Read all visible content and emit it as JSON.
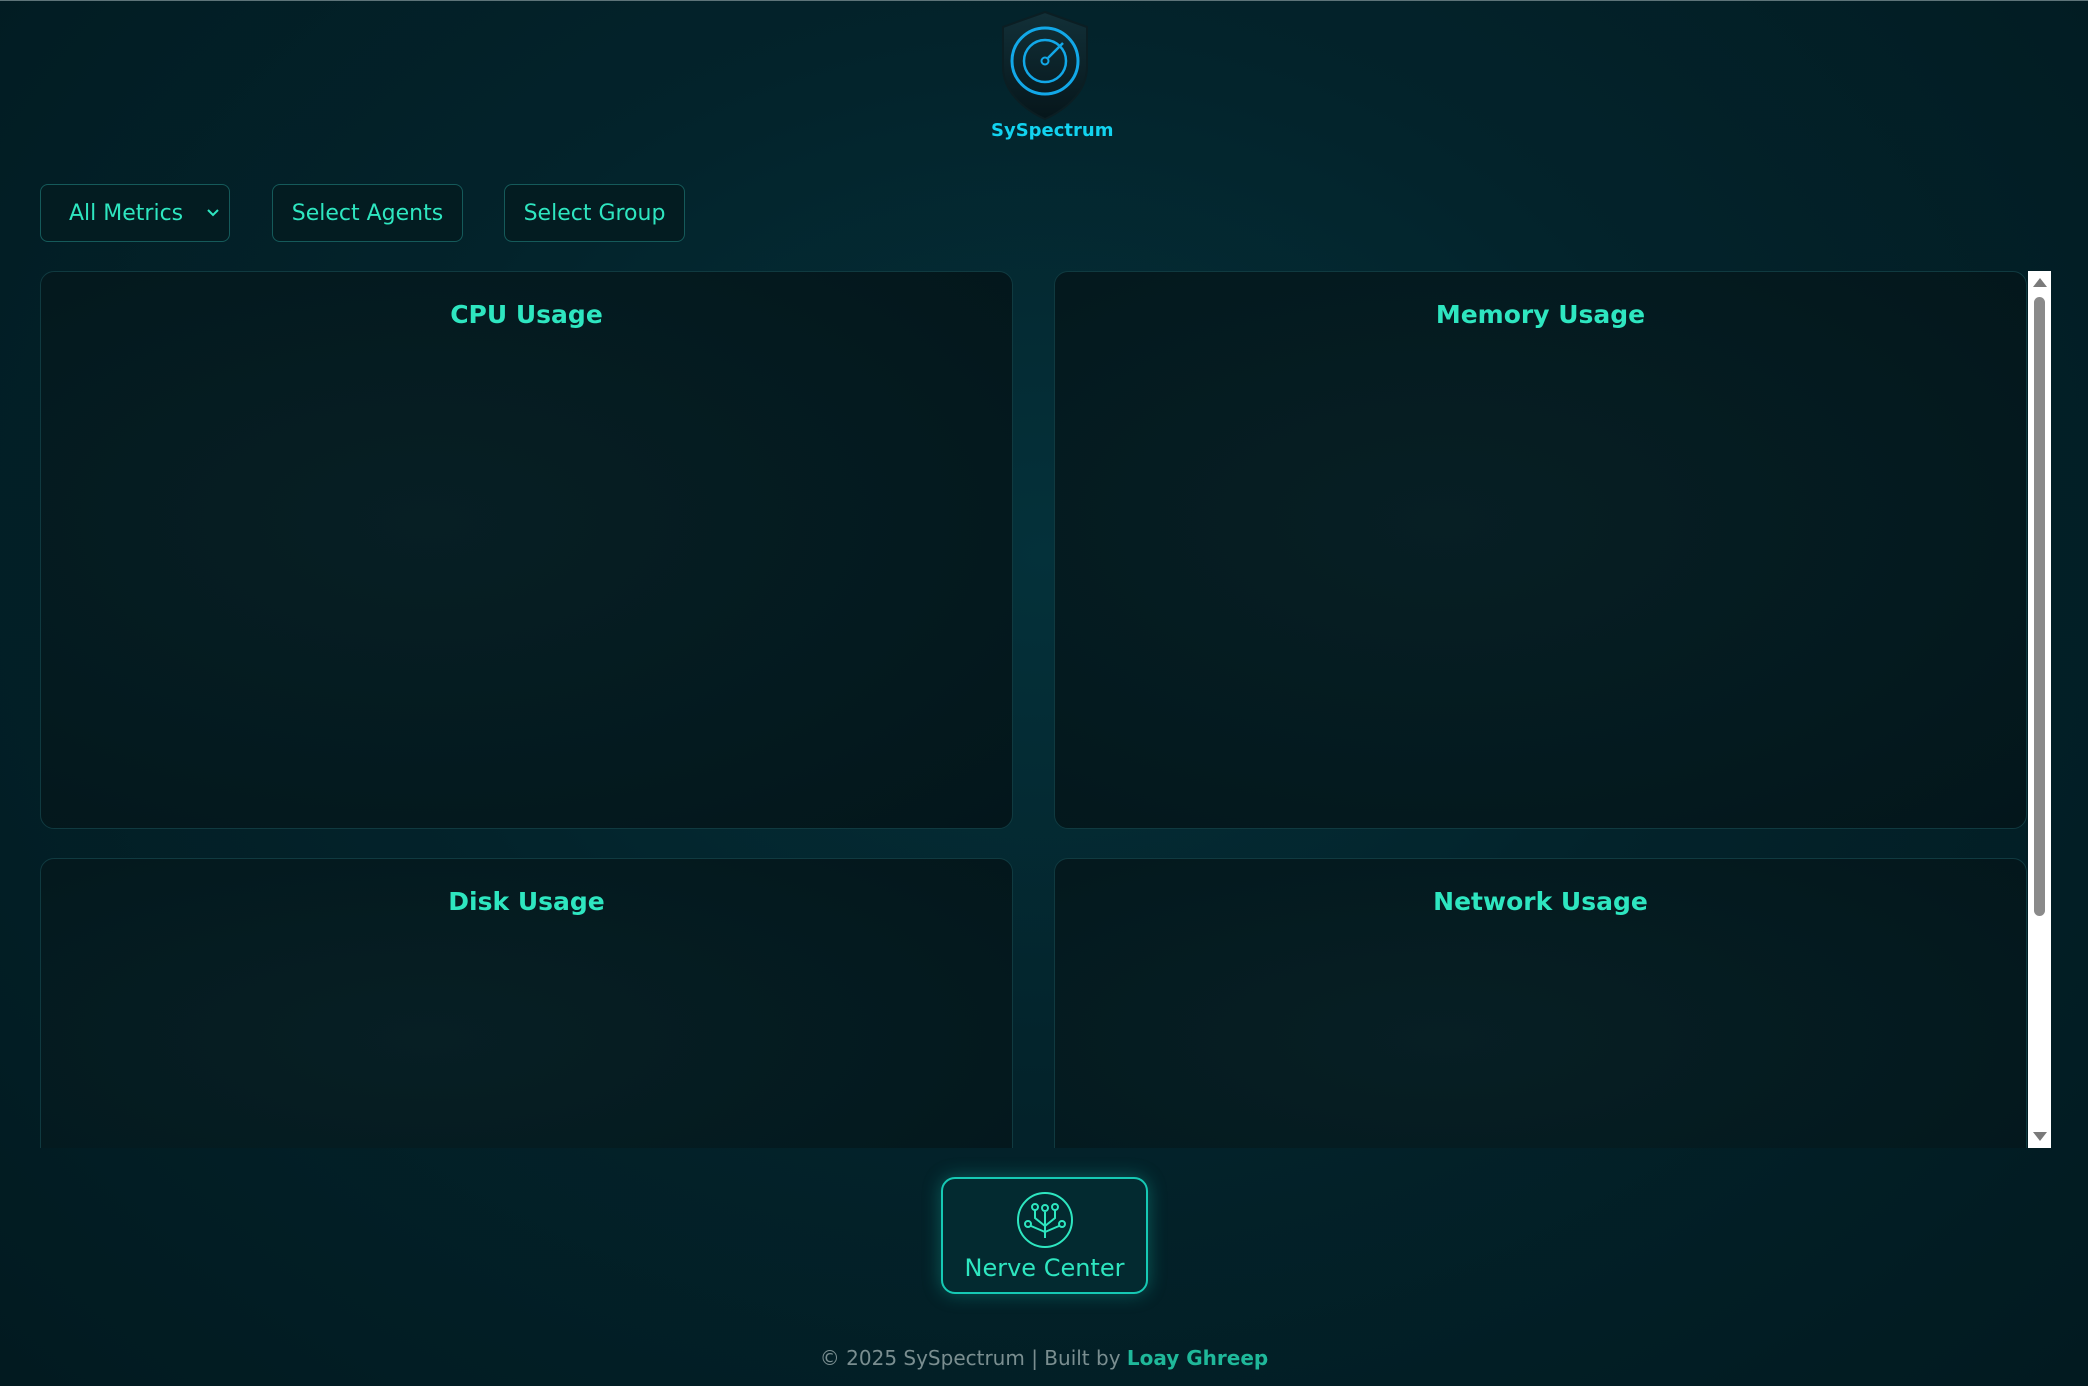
{
  "brand": {
    "name": "SySpectrum",
    "logo_icon": "shield-radar-icon",
    "accent_color": "#12d3f0"
  },
  "toolbar": {
    "metrics_select": {
      "selected": "All Metrics"
    },
    "select_agents_label": "Select Agents",
    "select_group_label": "Select Group"
  },
  "cards": [
    {
      "title": "CPU Usage"
    },
    {
      "title": "Memory Usage"
    },
    {
      "title": "Disk Usage"
    },
    {
      "title": "Network Usage"
    }
  ],
  "nerve_center": {
    "label": "Nerve Center",
    "icon": "circuit-tree-icon"
  },
  "footer": {
    "text": "© 2025 SySpectrum | Built by ",
    "author": "Loay Ghreep"
  },
  "colors": {
    "accent": "#2ee6c0",
    "background": "#03232b"
  }
}
